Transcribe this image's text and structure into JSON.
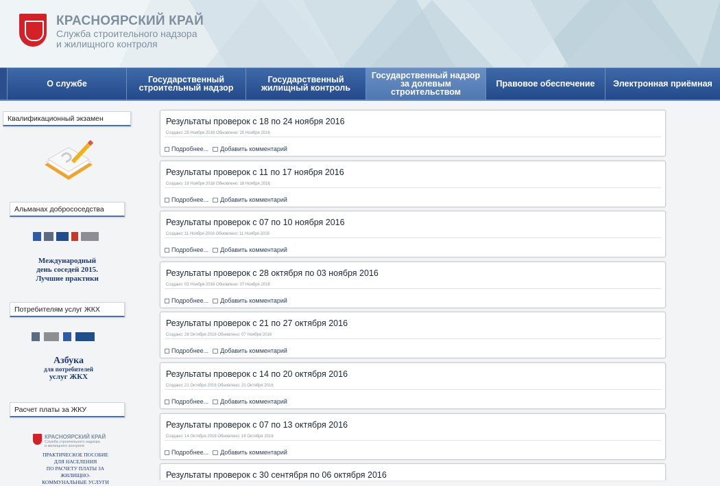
{
  "header": {
    "region": "КРАСНОЯРСКИЙ КРАЙ",
    "service_line1": "Служба строительного надзора",
    "service_line2": "и жилищного контроля"
  },
  "nav": [
    {
      "label": "О службе",
      "active": false
    },
    {
      "label": "Государственный строительный надзор",
      "active": false
    },
    {
      "label": "Государственный жилищный контроль",
      "active": false
    },
    {
      "label": "Государственный надзор за долевым строительством",
      "active": true
    },
    {
      "label": "Правовое обеспечение",
      "active": false
    },
    {
      "label": "Электронная приёмная",
      "active": false
    }
  ],
  "sidebar": {
    "sections": [
      {
        "title": "Квалификационный экзамен"
      },
      {
        "title": "Альманах добрососедства",
        "banner": [
          "Международный",
          "день соседей 2015.",
          "Лучшие практики"
        ]
      },
      {
        "title": "Потребителям услуг ЖКХ",
        "banner": [
          "Азбука",
          "для потребителей",
          "услуг ЖКХ"
        ]
      },
      {
        "title": "Расчет платы за ЖКУ",
        "banner": [
          "КРАСНОЯРСКИЙ КРАЙ",
          "Служба строительного надзора",
          "и жилищного контроля",
          "ПРАКТИЧЕСКОЕ ПОСОБИЕ",
          "ДЛЯ НАСЕЛЕНИЯ",
          "ПО РАСЧЕТУ ПЛАТЫ ЗА",
          "ЖИЛИЩНО-",
          "КОММУНАЛЬНЫЕ УСЛУГИ"
        ]
      }
    ]
  },
  "articles": [
    {
      "title": "Результаты проверок с 18 по 24 ноября 2016",
      "meta": "Создано: 25 Ноября 2016 Обновлено: 25 Ноября 2016"
    },
    {
      "title": "Результаты проверок с 11 по 17 ноября 2016",
      "meta": "Создано: 18 Ноября 2016 Обновлено: 18 Ноября 2016"
    },
    {
      "title": "Результаты проверок с 07 по 10 ноября 2016",
      "meta": "Создано: 11 Ноября 2016 Обновлено: 11 Ноября 2016"
    },
    {
      "title": "Результаты проверок с 28 октября по 03 ноября 2016",
      "meta": "Создано: 03 Ноября 2016 Обновлено: 07 Ноября 2016"
    },
    {
      "title": "Результаты проверок с 21 по 27 октября 2016",
      "meta": "Создано: 28 Октября 2016 Обновлено: 07 Ноября 2016"
    },
    {
      "title": "Результаты проверок с 14 по 20 октября 2016",
      "meta": "Создано: 21 Октября 2016 Обновлено: 21 Октября 2016"
    },
    {
      "title": "Результаты проверок с 07 по 13 октября 2016",
      "meta": "Создано: 14 Октября 2016 Обновлено: 14 Октября 2016"
    },
    {
      "title": "Результаты проверок с 30 сентября по 06 октября 2016",
      "meta": ""
    }
  ],
  "article_actions": {
    "more": "Подробнее...",
    "comment": "Добавить комментарий"
  }
}
